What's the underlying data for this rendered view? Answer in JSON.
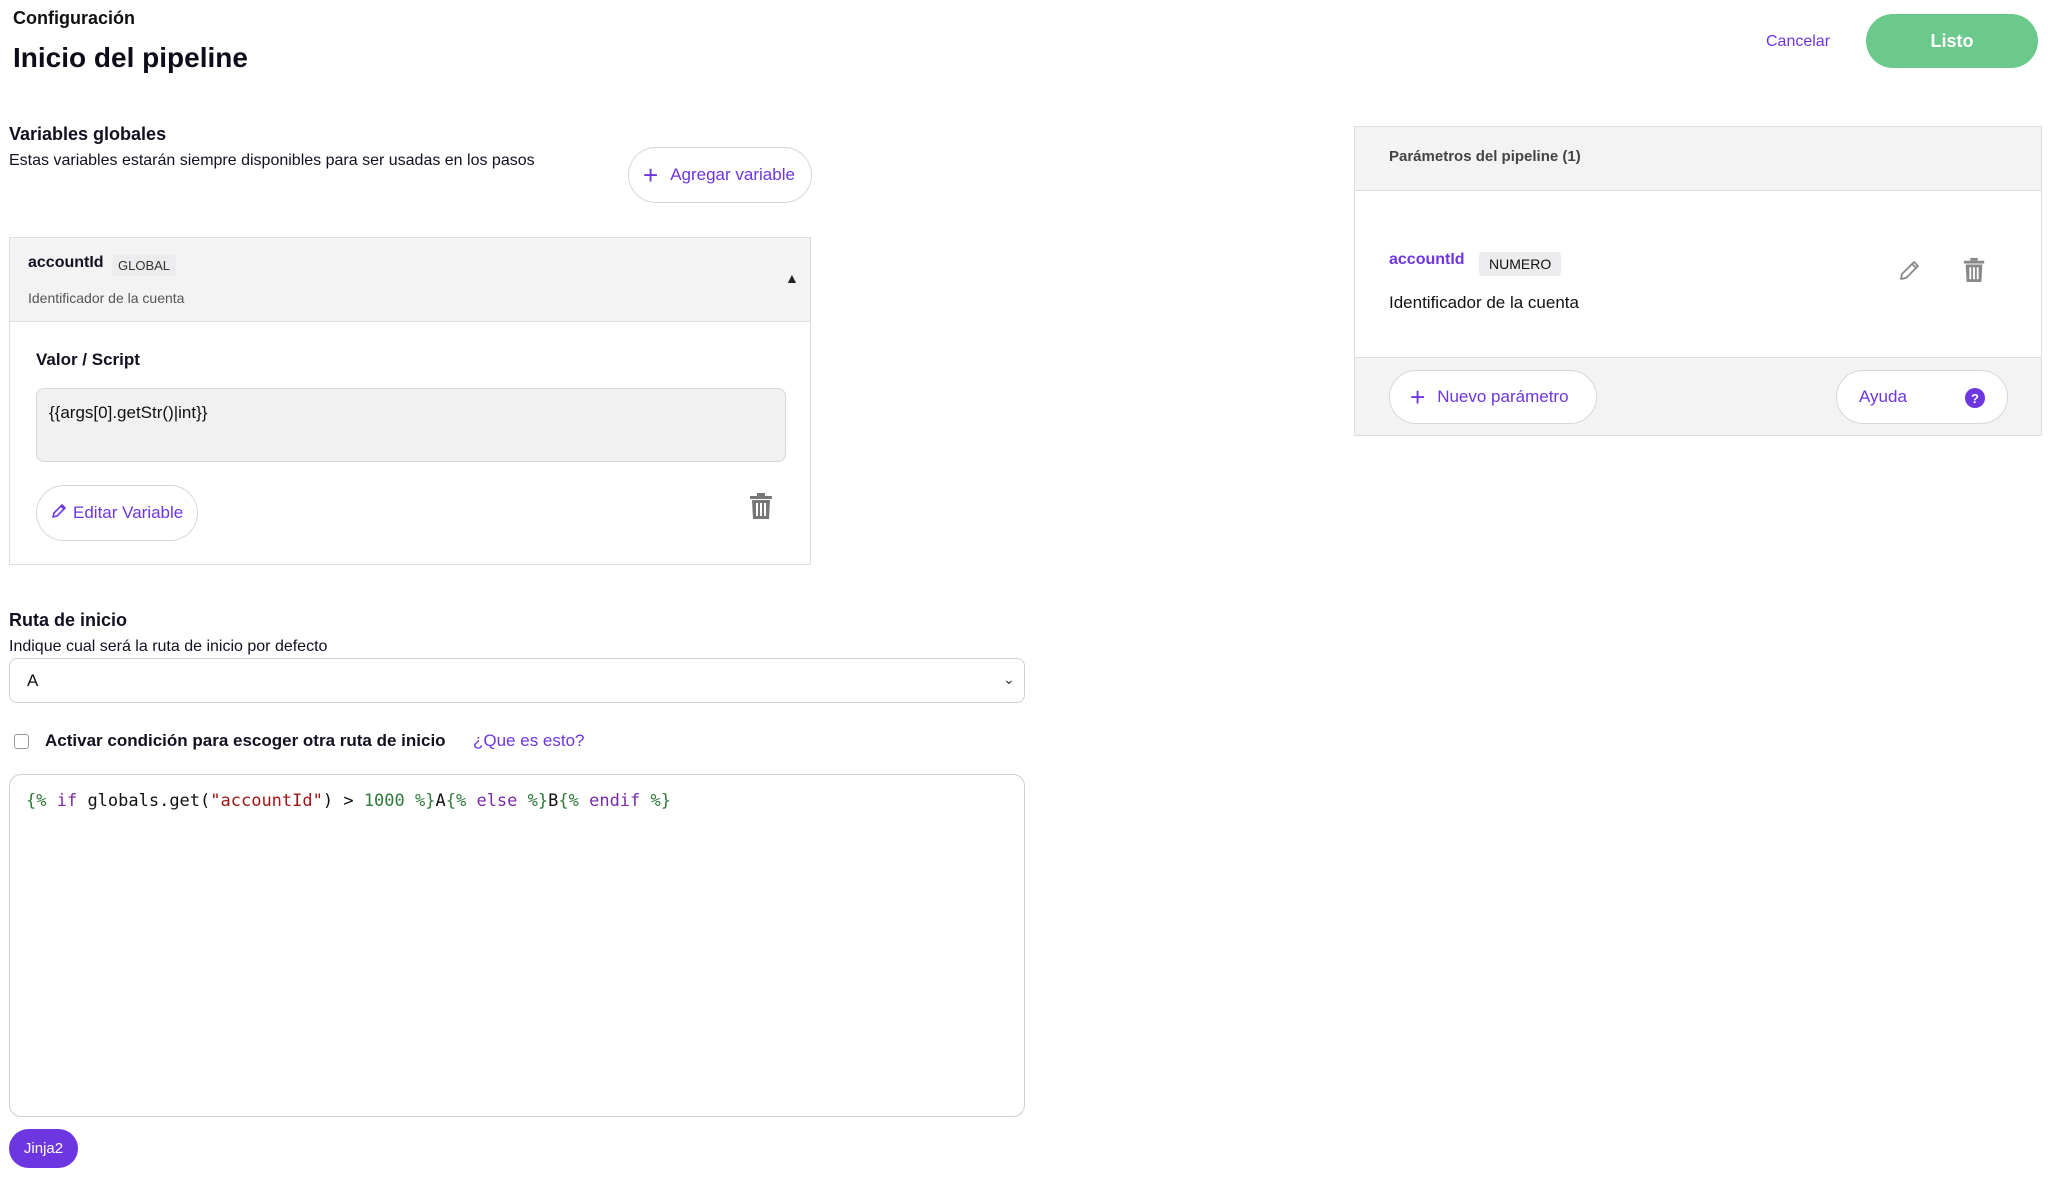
{
  "header": {
    "breadcrumb": "Configuración",
    "title": "Inicio del pipeline",
    "cancel_label": "Cancelar",
    "done_label": "Listo"
  },
  "globals": {
    "title": "Variables globales",
    "description": "Estas variables estarán siempre disponibles para ser usadas en los pasos",
    "add_label": "Agregar variable",
    "variable": {
      "name": "accountId",
      "scope_tag": "GLOBAL",
      "description": "Identificador de la cuenta",
      "value_label": "Valor / Script",
      "value": "{{args[0].getStr()|int}}",
      "edit_label": "Editar Variable"
    }
  },
  "start_route": {
    "title": "Ruta de inicio",
    "description": "Indique cual será la ruta de inicio por defecto",
    "selected": "A",
    "condition_label": "Activar condición para escoger otra ruta de inicio",
    "help_link": "¿Que es esto?",
    "code": {
      "t1": "{%",
      "k1": " if",
      "p1": " globals.get(",
      "s1": "\"accountId\"",
      "p2": ") > ",
      "n1": "1000",
      "t2": " %}",
      "p3": "A",
      "t3": "{%",
      "k2": " else",
      "t4": " %}",
      "p4": "B",
      "t5": "{%",
      "k3": " endif",
      "t6": " %}"
    },
    "language_badge": "Jinja2"
  },
  "params_panel": {
    "title": "Parámetros del pipeline (1)",
    "param": {
      "name": "accountId",
      "type": "NUMERO",
      "description": "Identificador de la cuenta"
    },
    "new_label": "Nuevo parámetro",
    "help_label": "Ayuda",
    "help_icon_glyph": "?"
  },
  "icons": {
    "plus": "+",
    "caret_up": "▲",
    "chevron_down": "⌄"
  },
  "colors": {
    "accent": "#6d36e0",
    "done_button": "#6cc98c"
  }
}
